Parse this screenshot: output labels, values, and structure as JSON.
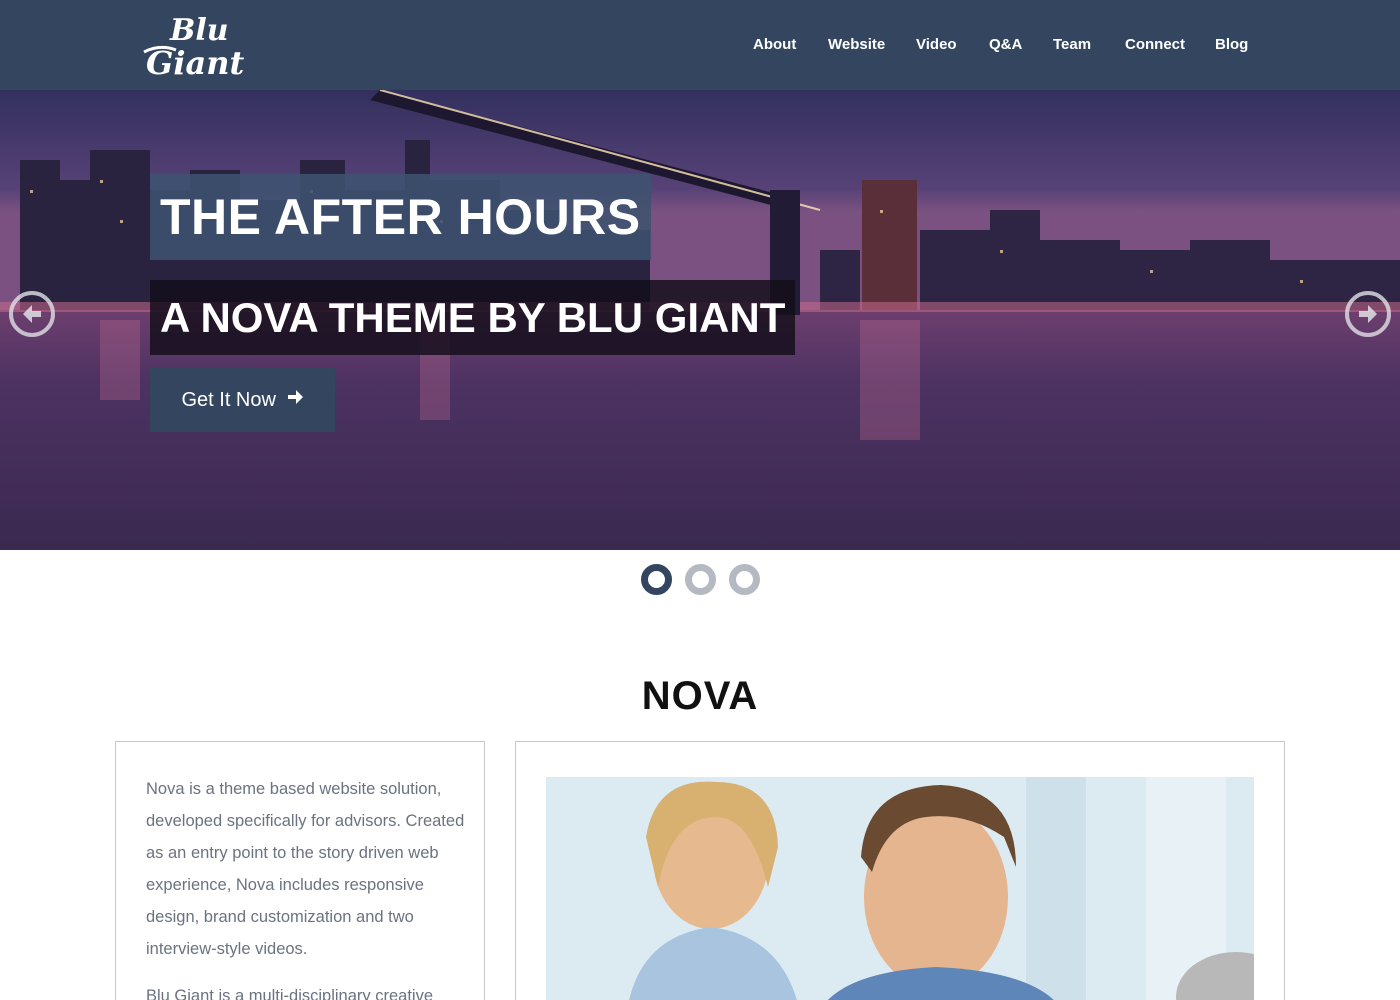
{
  "header": {
    "logo_text": "Blu Giant",
    "nav": [
      "About",
      "Website",
      "Video",
      "Q&A",
      "Team",
      "Connect",
      "Blog"
    ]
  },
  "hero": {
    "title": "THE AFTER HOURS",
    "subtitle": "A NOVA THEME BY BLU GIANT",
    "cta_label": "Get It Now",
    "prev_icon": "arrow-left-circle-icon",
    "next_icon": "arrow-right-circle-icon",
    "slide_count": 3,
    "active_slide": 1
  },
  "section": {
    "title": "NOVA",
    "paragraph_1": "Nova is a theme based website solution, developed specifically for advisors. Created as an entry point to the story driven web experience, Nova includes responsive design, brand customization and two interview-style videos.",
    "paragraph_2": "Blu Giant is a multi-disciplinary creative"
  },
  "colors": {
    "header_bg": "#34465f",
    "accent": "#34465f",
    "text_muted": "#6b7280",
    "dot_inactive": "#b5bac2"
  }
}
